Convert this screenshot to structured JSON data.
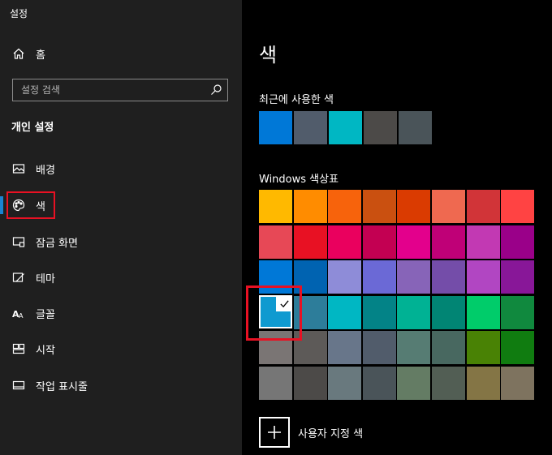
{
  "app": {
    "title": "설정"
  },
  "sidebar": {
    "home_label": "홈",
    "search_placeholder": "설정 검색",
    "section_title": "개인 설정",
    "items": [
      {
        "label": "배경",
        "icon": "picture-icon"
      },
      {
        "label": "색",
        "icon": "palette-icon"
      },
      {
        "label": "잠금 화면",
        "icon": "lock-screen-icon"
      },
      {
        "label": "테마",
        "icon": "theme-brush-icon"
      },
      {
        "label": "글꼴",
        "icon": "font-icon"
      },
      {
        "label": "시작",
        "icon": "start-grid-icon"
      },
      {
        "label": "작업 표시줄",
        "icon": "taskbar-icon"
      }
    ],
    "active_item": "색"
  },
  "main": {
    "title": "색",
    "recent_title": "최근에 사용한 색",
    "recent_colors": [
      "#0078d7",
      "#515c6b",
      "#00b7c3",
      "#4c4a48",
      "#4a5459"
    ],
    "palette_title": "Windows 색상표",
    "palette": [
      [
        "#ffb900",
        "#ff8c00",
        "#f7630c",
        "#ca5010",
        "#da3b01",
        "#ef6950",
        "#d13438",
        "#ff4343"
      ],
      [
        "#e74856",
        "#e81123",
        "#ea005e",
        "#c30052",
        "#e3008c",
        "#bf0077",
        "#c239b3",
        "#9a0089"
      ],
      [
        "#0078d7",
        "#0063b1",
        "#8e8cd8",
        "#6b69d6",
        "#8764b8",
        "#744da9",
        "#b146c2",
        "#881798"
      ],
      [
        "#0099bc",
        "#2d7d9a",
        "#00b7c3",
        "#038387",
        "#00b294",
        "#018574",
        "#00cc6a",
        "#10893e"
      ],
      [
        "#7a7574",
        "#5d5a58",
        "#68768a",
        "#515c6b",
        "#567c73",
        "#486860",
        "#498205",
        "#107c10"
      ],
      [
        "#767676",
        "#4c4a48",
        "#69797e",
        "#4a5459",
        "#647c64",
        "#525e54",
        "#847545",
        "#7e735f"
      ]
    ],
    "selected": {
      "row": 3,
      "col": 0,
      "color": "#0f9ad0"
    },
    "custom_color_label": "사용자 지정 색"
  },
  "colors": {
    "accent_indicator": "#1a84d1",
    "highlight": "#e81123"
  }
}
